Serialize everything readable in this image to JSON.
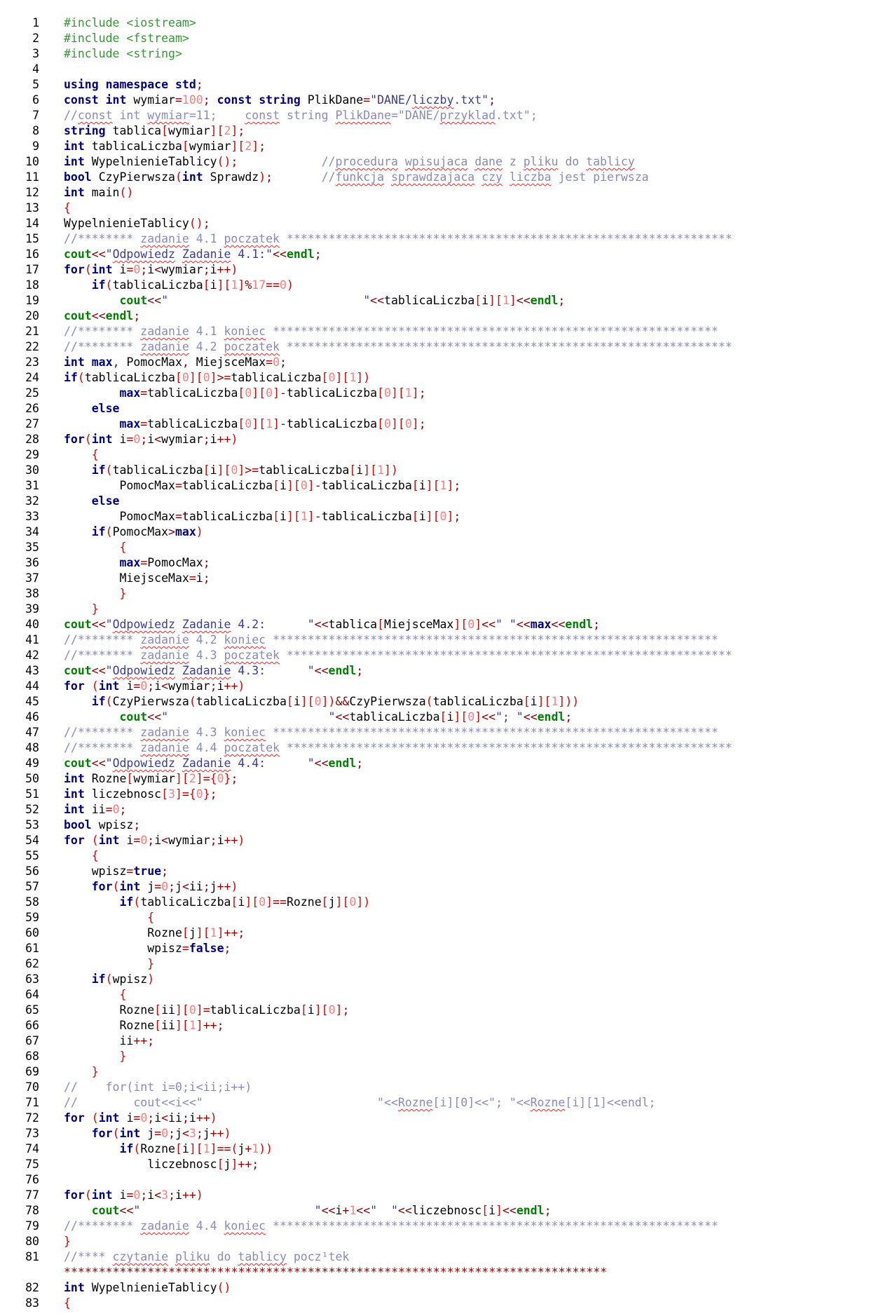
{
  "colors": {
    "preprocessor": "#339933",
    "keyword": "#000080",
    "stream": "#008000",
    "number": "#ff7d7d",
    "string": "#3b3b9e",
    "comment": "#8a8aba",
    "bracket": "#dd0000",
    "spell_underline": "#e03030"
  },
  "lines": [
    {
      "n": "1",
      "t": "#include <iostream>"
    },
    {
      "n": "2",
      "t": "#include <fstream>"
    },
    {
      "n": "3",
      "t": "#include <string>"
    },
    {
      "n": "4",
      "t": ""
    },
    {
      "n": "5",
      "t": "using namespace std;"
    },
    {
      "n": "6",
      "t": "const int wymiar=100; const string PlikDane=\"DANE/liczby.txt\";"
    },
    {
      "n": "7",
      "t": "//const int wymiar=11;    const string PlikDane=\"DANE/przyklad.txt\";"
    },
    {
      "n": "8",
      "t": "string tablica[wymiar][2];"
    },
    {
      "n": "9",
      "t": "int tablicaLiczba[wymiar][2];"
    },
    {
      "n": "10",
      "t": "int WypelnienieTablicy();            //procedura wpisujaca dane z pliku do tablicy"
    },
    {
      "n": "11",
      "t": "bool CzyPierwsza(int Sprawdz);       //funkcja sprawdzajaca czy liczba jest pierwsza"
    },
    {
      "n": "12",
      "t": "int main()"
    },
    {
      "n": "13",
      "t": "{"
    },
    {
      "n": "14",
      "t": "WypelnienieTablicy();"
    },
    {
      "n": "15",
      "t": "//******** zadanie 4.1 poczatek ****************************************************************"
    },
    {
      "n": "16",
      "t": "cout<<\"Odpowiedz Zadanie 4.1:\"<<endl;"
    },
    {
      "n": "17",
      "t": "for(int i=0;i<wymiar;i++)"
    },
    {
      "n": "18",
      "t": "    if(tablicaLiczba[i][1]%17==0)"
    },
    {
      "n": "19",
      "t": "        cout<<\"                            \"<<tablicaLiczba[i][1]<<endl;"
    },
    {
      "n": "20",
      "t": "cout<<endl;"
    },
    {
      "n": "21",
      "t": "//******** zadanie 4.1 koniec ****************************************************************"
    },
    {
      "n": "22",
      "t": "//******** zadanie 4.2 poczatek ****************************************************************"
    },
    {
      "n": "23",
      "t": "int max, PomocMax, MiejsceMax=0;"
    },
    {
      "n": "24",
      "t": "if(tablicaLiczba[0][0]>=tablicaLiczba[0][1])"
    },
    {
      "n": "25",
      "t": "        max=tablicaLiczba[0][0]-tablicaLiczba[0][1];"
    },
    {
      "n": "26",
      "t": "    else"
    },
    {
      "n": "27",
      "t": "        max=tablicaLiczba[0][1]-tablicaLiczba[0][0];"
    },
    {
      "n": "28",
      "t": "for(int i=0;i<wymiar;i++)"
    },
    {
      "n": "29",
      "t": "    {"
    },
    {
      "n": "30",
      "t": "    if(tablicaLiczba[i][0]>=tablicaLiczba[i][1])"
    },
    {
      "n": "31",
      "t": "        PomocMax=tablicaLiczba[i][0]-tablicaLiczba[i][1];"
    },
    {
      "n": "32",
      "t": "    else"
    },
    {
      "n": "33",
      "t": "        PomocMax=tablicaLiczba[i][1]-tablicaLiczba[i][0];"
    },
    {
      "n": "34",
      "t": "    if(PomocMax>max)"
    },
    {
      "n": "35",
      "t": "        {"
    },
    {
      "n": "36",
      "t": "        max=PomocMax;"
    },
    {
      "n": "37",
      "t": "        MiejsceMax=i;"
    },
    {
      "n": "38",
      "t": "        }"
    },
    {
      "n": "39",
      "t": "    }"
    },
    {
      "n": "40",
      "t": "cout<<\"Odpowiedz Zadanie 4.2:      \"<<tablica[MiejsceMax][0]<<\" \"<<max<<endl;"
    },
    {
      "n": "41",
      "t": "//******** zadanie 4.2 koniec ****************************************************************"
    },
    {
      "n": "42",
      "t": "//******** zadanie 4.3 poczatek ****************************************************************"
    },
    {
      "n": "43",
      "t": "cout<<\"Odpowiedz Zadanie 4.3:      \"<<endl;"
    },
    {
      "n": "44",
      "t": "for (int i=0;i<wymiar;i++)"
    },
    {
      "n": "45",
      "t": "    if(CzyPierwsza(tablicaLiczba[i][0])&&CzyPierwsza(tablicaLiczba[i][1]))"
    },
    {
      "n": "46",
      "t": "        cout<<\"                       \"<<tablicaLiczba[i][0]<<\"; \"<<endl;"
    },
    {
      "n": "47",
      "t": "//******** zadanie 4.3 koniec ****************************************************************"
    },
    {
      "n": "48",
      "t": "//******** zadanie 4.4 poczatek ****************************************************************"
    },
    {
      "n": "49",
      "t": "cout<<\"Odpowiedz Zadanie 4.4:      \"<<endl;"
    },
    {
      "n": "50",
      "t": "int Rozne[wymiar][2]={0};"
    },
    {
      "n": "51",
      "t": "int liczebnosc[3]={0};"
    },
    {
      "n": "52",
      "t": "int ii=0;"
    },
    {
      "n": "53",
      "t": "bool wpisz;"
    },
    {
      "n": "54",
      "t": "for (int i=0;i<wymiar;i++)"
    },
    {
      "n": "55",
      "t": "    {"
    },
    {
      "n": "56",
      "t": "    wpisz=true;"
    },
    {
      "n": "57",
      "t": "    for(int j=0;j<ii;j++)"
    },
    {
      "n": "58",
      "t": "        if(tablicaLiczba[i][0]==Rozne[j][0])"
    },
    {
      "n": "59",
      "t": "            {"
    },
    {
      "n": "60",
      "t": "            Rozne[j][1]++;"
    },
    {
      "n": "61",
      "t": "            wpisz=false;"
    },
    {
      "n": "62",
      "t": "            }"
    },
    {
      "n": "63",
      "t": "    if(wpisz)"
    },
    {
      "n": "64",
      "t": "        {"
    },
    {
      "n": "65",
      "t": "        Rozne[ii][0]=tablicaLiczba[i][0];"
    },
    {
      "n": "66",
      "t": "        Rozne[ii][1]++;"
    },
    {
      "n": "67",
      "t": "        ii++;"
    },
    {
      "n": "68",
      "t": "        }"
    },
    {
      "n": "69",
      "t": "    }"
    },
    {
      "n": "70",
      "t": "//    for(int i=0;i<ii;i++)"
    },
    {
      "n": "71",
      "t": "//        cout<<i<<\"                         \"<<Rozne[i][0]<<\"; \"<<Rozne[i][1]<<endl;"
    },
    {
      "n": "72",
      "t": "for (int i=0;i<ii;i++)"
    },
    {
      "n": "73",
      "t": "    for(int j=0;j<3;j++)"
    },
    {
      "n": "74",
      "t": "        if(Rozne[i][1]==(j+1))"
    },
    {
      "n": "75",
      "t": "            liczebnosc[j]++;"
    },
    {
      "n": "76",
      "t": ""
    },
    {
      "n": "77",
      "t": "for(int i=0;i<3;i++)"
    },
    {
      "n": "78",
      "t": "    cout<<\"                         \"<<i+1<<\"  \"<<liczebnosc[i]<<endl;"
    },
    {
      "n": "79",
      "t": "//******** zadanie 4.4 koniec ****************************************************************"
    },
    {
      "n": "80",
      "t": "}"
    },
    {
      "n": "81",
      "t": "//**** czytanie pliku do tablicy pocz¹tek\n******************************************************************************"
    },
    {
      "n": "82",
      "t": "int WypelnienieTablicy()"
    },
    {
      "n": "83",
      "t": "{"
    }
  ]
}
